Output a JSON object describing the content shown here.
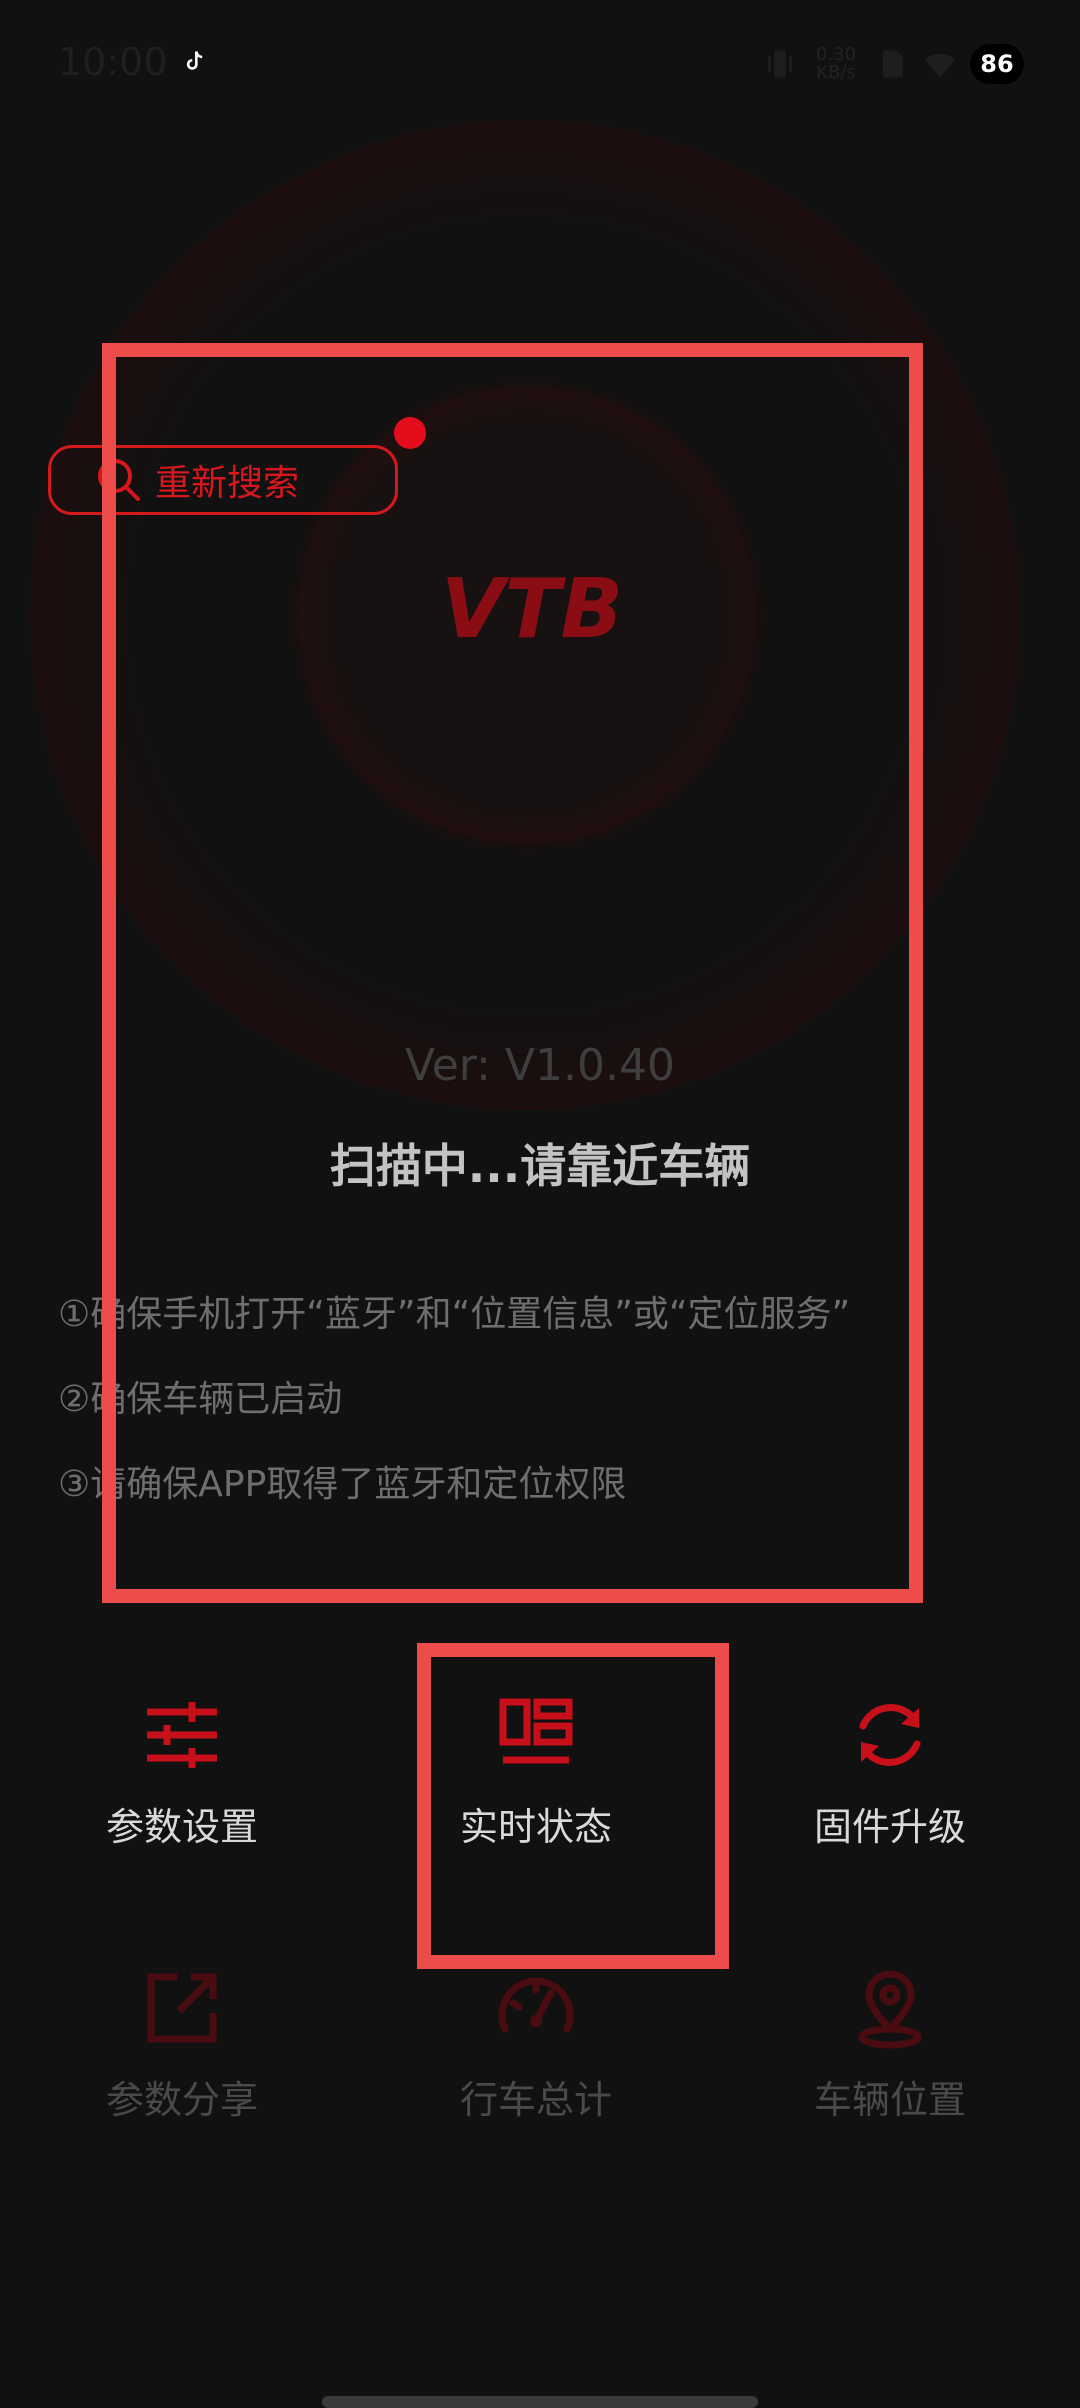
{
  "status_bar": {
    "time": "10:00",
    "net_speed_value": "0.30",
    "net_speed_unit": "KB/s",
    "battery": "86"
  },
  "colors": {
    "background": "#111111",
    "accent_red": "#d8161e",
    "highlight_box": "#ee4b4b"
  },
  "research_button": {
    "label": "重新搜索",
    "icon": "search-icon"
  },
  "logo": {
    "text": "VTB"
  },
  "version": "Ver: V1.0.40",
  "scan_status": "扫描中...请靠近车辆",
  "tips": [
    "①确保手机打开“蓝牙”和“位置信息”或“定位服务”",
    "②确保车辆已启动",
    "③请确保APP取得了蓝牙和定位权限"
  ],
  "menu": {
    "row1": [
      {
        "label": "参数设置",
        "icon": "sliders-icon"
      },
      {
        "label": "实时状态",
        "icon": "dashboard-layout-icon"
      },
      {
        "label": "固件升级",
        "icon": "refresh-icon"
      }
    ],
    "row2": [
      {
        "label": "参数分享",
        "icon": "share-icon"
      },
      {
        "label": "行车总计",
        "icon": "speedometer-icon"
      },
      {
        "label": "车辆位置",
        "icon": "location-pin-icon"
      }
    ]
  }
}
